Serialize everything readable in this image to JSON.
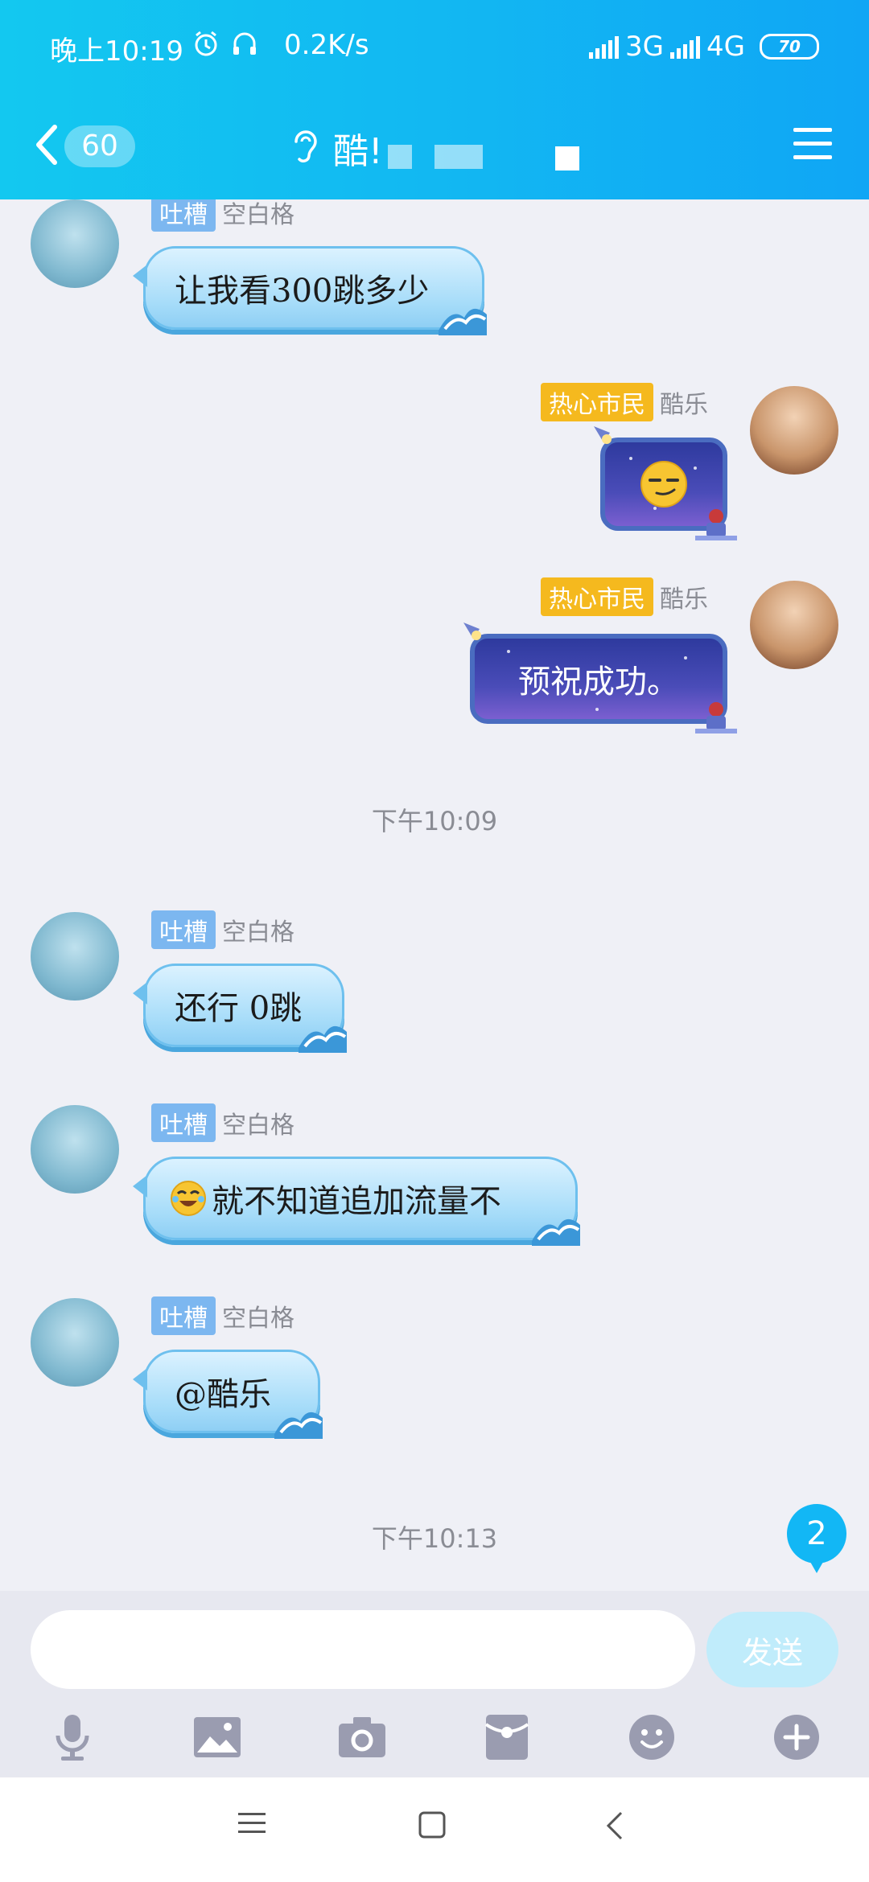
{
  "status_bar": {
    "time": "晚上10:19",
    "speed": "0.2K/s",
    "network1": "3G",
    "network2": "4G",
    "battery": "70",
    "icons": [
      "alarm-icon",
      "headset-icon",
      "signal-icon",
      "battery-icon"
    ]
  },
  "header": {
    "back_count": "60",
    "title": "酷!",
    "icons": [
      "back-chevron-icon",
      "ear-icon",
      "menu-icon"
    ]
  },
  "messages": [
    {
      "side": "left",
      "tag": "吐槽",
      "name": "空白格",
      "text": "让我看300跳多少"
    },
    {
      "side": "right",
      "tag": "热心市民",
      "name": "酷乐",
      "text": "",
      "emoji": "smirk-emoji"
    },
    {
      "side": "right",
      "tag": "热心市民",
      "name": "酷乐",
      "text": "预祝成功。"
    },
    {
      "type": "time",
      "text": "下午10:09"
    },
    {
      "side": "left",
      "tag": "吐槽",
      "name": "空白格",
      "text": "还行 0跳"
    },
    {
      "side": "left",
      "tag": "吐槽",
      "name": "空白格",
      "text": "就不知道追加流量不",
      "emoji": "laugh-cry-emoji"
    },
    {
      "side": "left",
      "tag": "吐槽",
      "name": "空白格",
      "text": "@酷乐"
    },
    {
      "type": "time",
      "text": "下午10:13"
    }
  ],
  "unread_badge": "2",
  "input": {
    "placeholder": "",
    "send_label": "发送"
  },
  "toolbar": [
    "mic-icon",
    "image-icon",
    "camera-icon",
    "red-packet-icon",
    "emoji-icon",
    "plus-icon"
  ],
  "colors": {
    "accent": "#12b7f5",
    "bubble_in": "#a6dcf9",
    "bubble_out": "#4a4cb8",
    "tag_blue": "#7cb7f0",
    "tag_orange": "#f5b91e"
  }
}
